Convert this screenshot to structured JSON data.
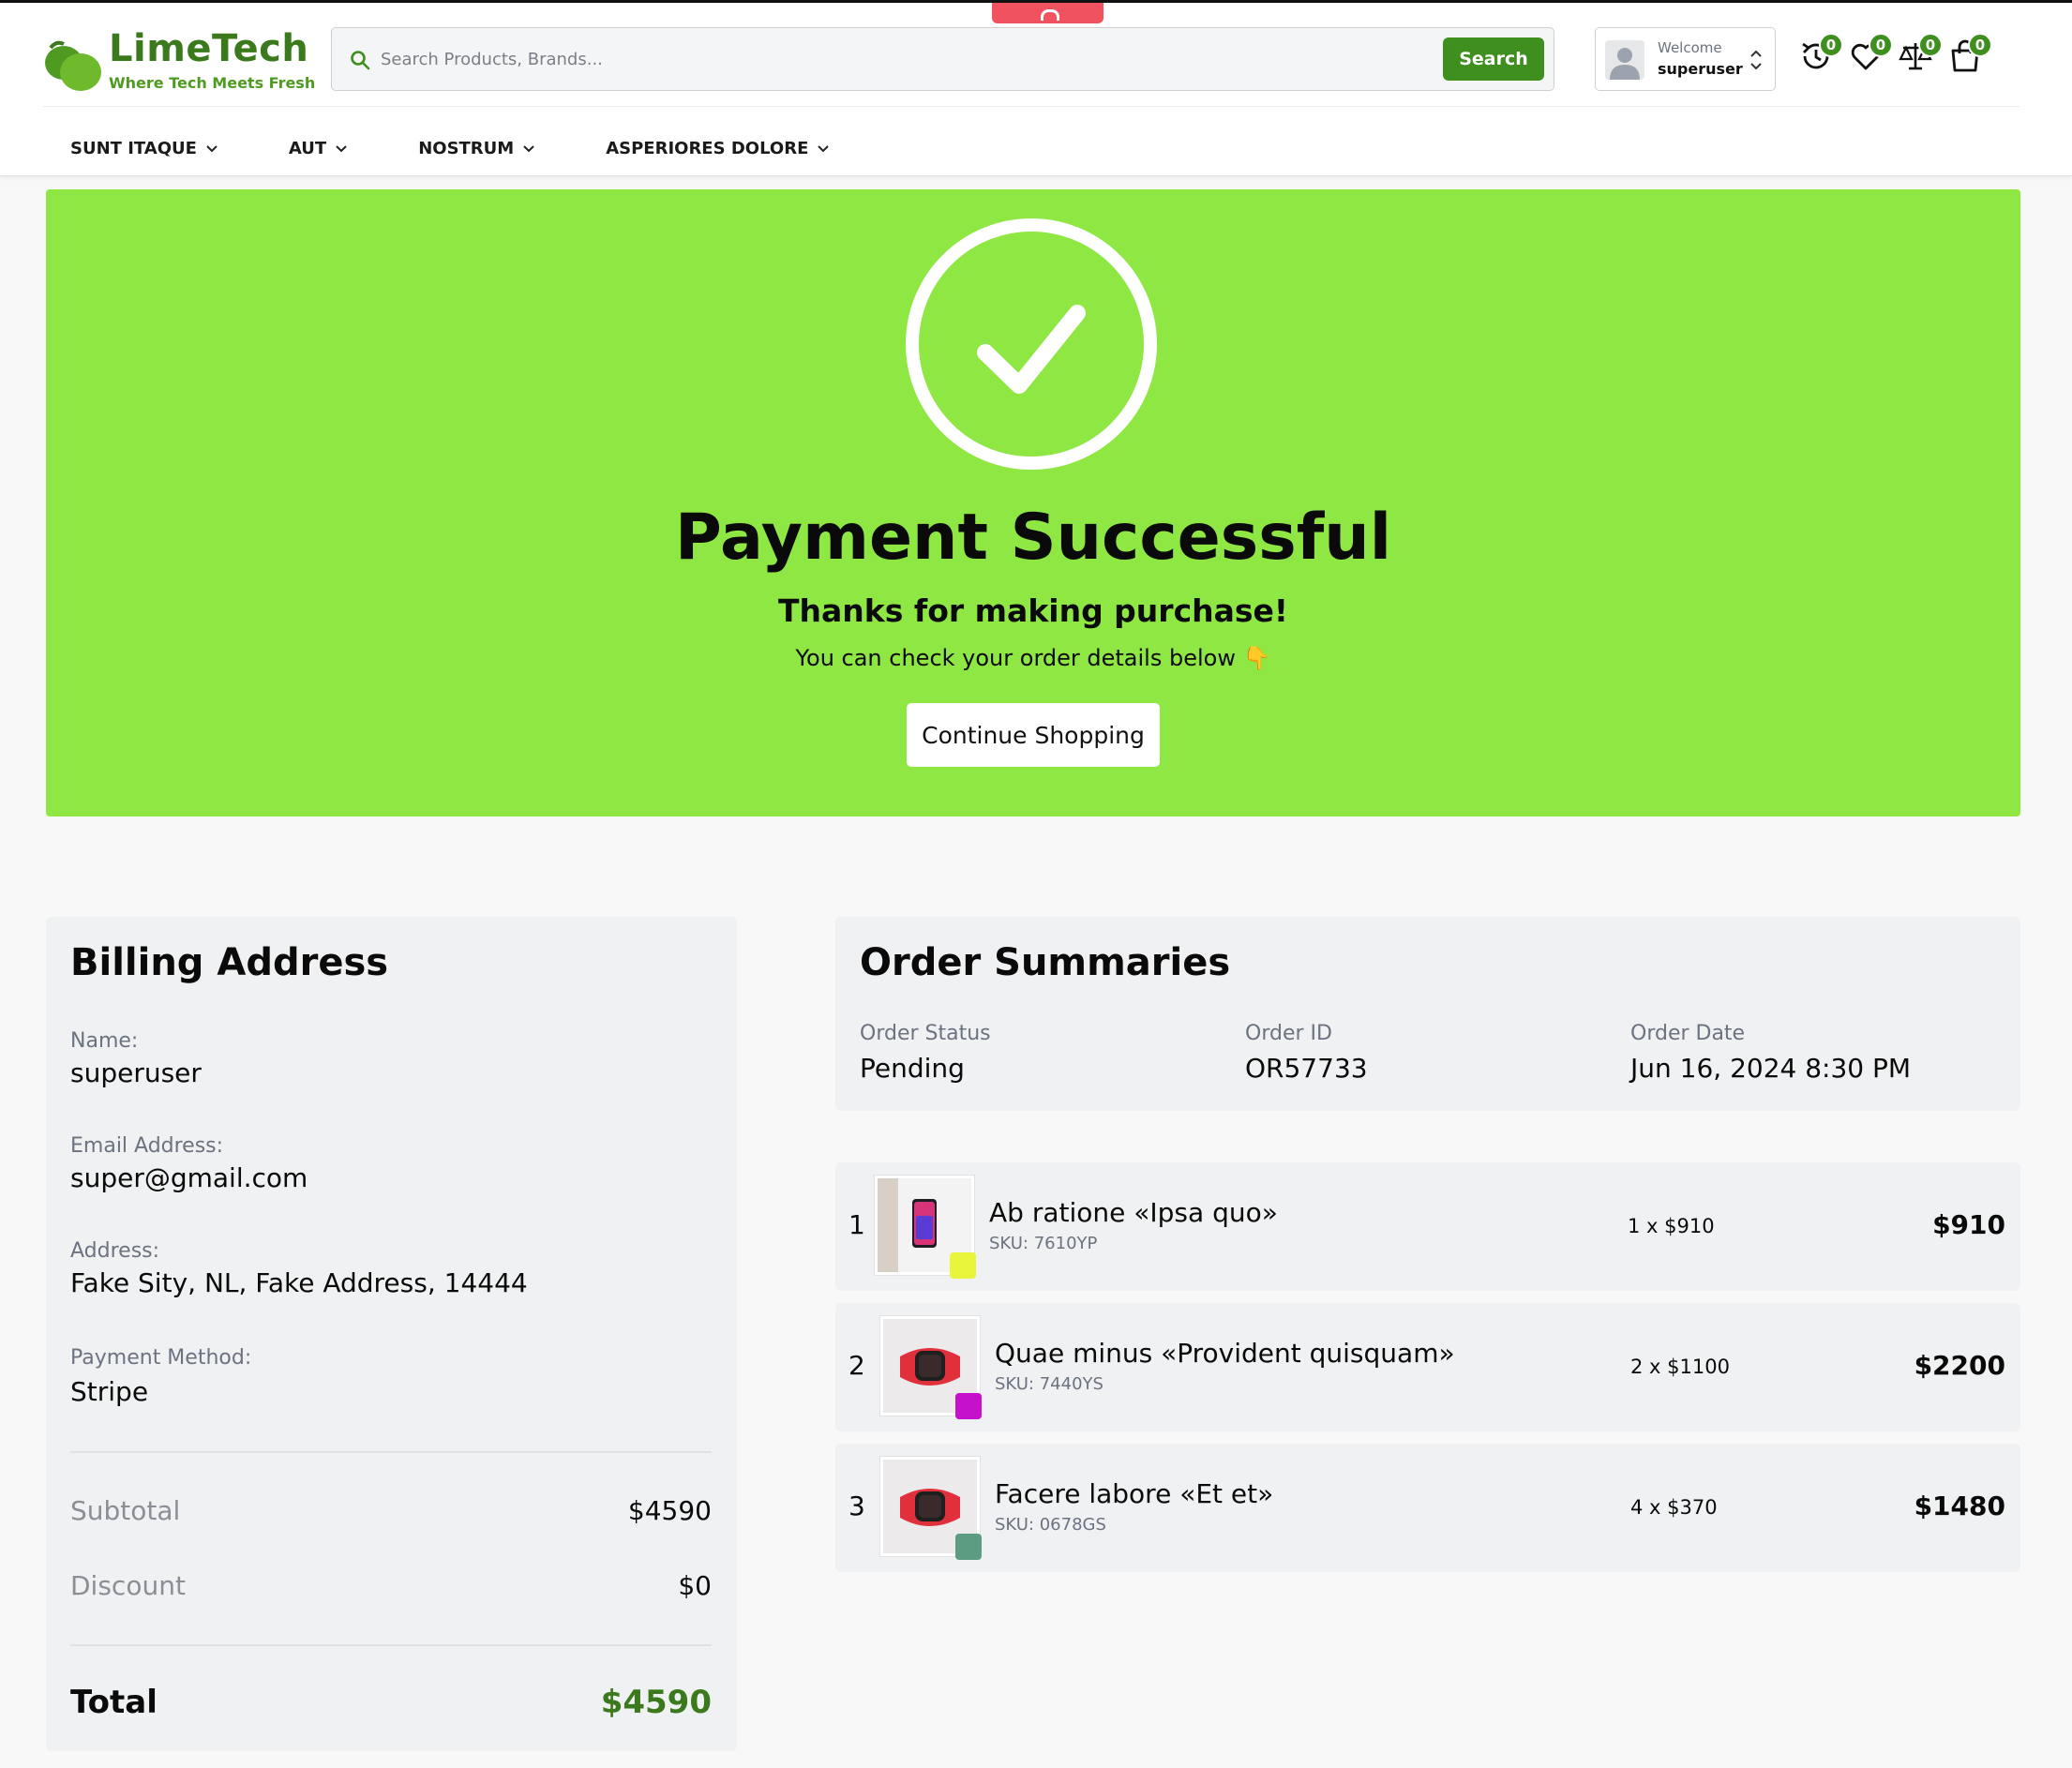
{
  "brand": {
    "name": "LimeTech",
    "tagline": "Where Tech Meets Fresh",
    "accent": "#3f8f1f",
    "hero_bg": "#8fe744"
  },
  "search": {
    "placeholder": "Search Products, Brands...",
    "button": "Search"
  },
  "user": {
    "welcome": "Welcome",
    "name": "superuser"
  },
  "header_icons": [
    {
      "icon": "history-icon",
      "count": "0"
    },
    {
      "icon": "heart-icon",
      "count": "0"
    },
    {
      "icon": "compare-scale-icon",
      "count": "0"
    },
    {
      "icon": "shopping-bag-icon",
      "count": "0"
    }
  ],
  "nav": [
    {
      "label": "SUNT ITAQUE"
    },
    {
      "label": "AUT"
    },
    {
      "label": "NOSTRUM"
    },
    {
      "label": "ASPERIORES DOLORE"
    }
  ],
  "hero": {
    "title": "Payment Successful",
    "subtitle": "Thanks for making purchase!",
    "note": "You can check your order details below 👇",
    "button": "Continue Shopping"
  },
  "billing": {
    "title": "Billing Address",
    "name_label": "Name:",
    "name": "superuser",
    "email_label": "Email Address:",
    "email": "super@gmail.com",
    "address_label": "Address:",
    "address": "Fake Sity, NL, Fake Address, 14444",
    "payment_label": "Payment Method:",
    "payment": "Stripe",
    "subtotal_label": "Subtotal",
    "subtotal": "$4590",
    "discount_label": "Discount",
    "discount": "$0",
    "total_label": "Total",
    "total": "$4590"
  },
  "summary": {
    "title": "Order Summaries",
    "status_label": "Order Status",
    "status": "Pending",
    "id_label": "Order ID",
    "id": "OR57733",
    "date_label": "Order Date",
    "date": "Jun 16, 2024 8:30 PM"
  },
  "items": [
    {
      "num": "1",
      "name": "Ab ratione «Ipsa quo»",
      "sku": "SKU: 7610YP",
      "qty": "1 x $910",
      "total": "$910",
      "swatch": "#e8f53a",
      "image": "phone"
    },
    {
      "num": "2",
      "name": "Quae minus «Provident quisquam»",
      "sku": "SKU: 7440YS",
      "qty": "2 x $1100",
      "total": "$2200",
      "swatch": "#c511c9",
      "image": "watch"
    },
    {
      "num": "3",
      "name": "Facere labore «Et et»",
      "sku": "SKU: 0678GS",
      "qty": "4 x $370",
      "total": "$1480",
      "swatch": "#5b9c83",
      "image": "watch"
    }
  ]
}
